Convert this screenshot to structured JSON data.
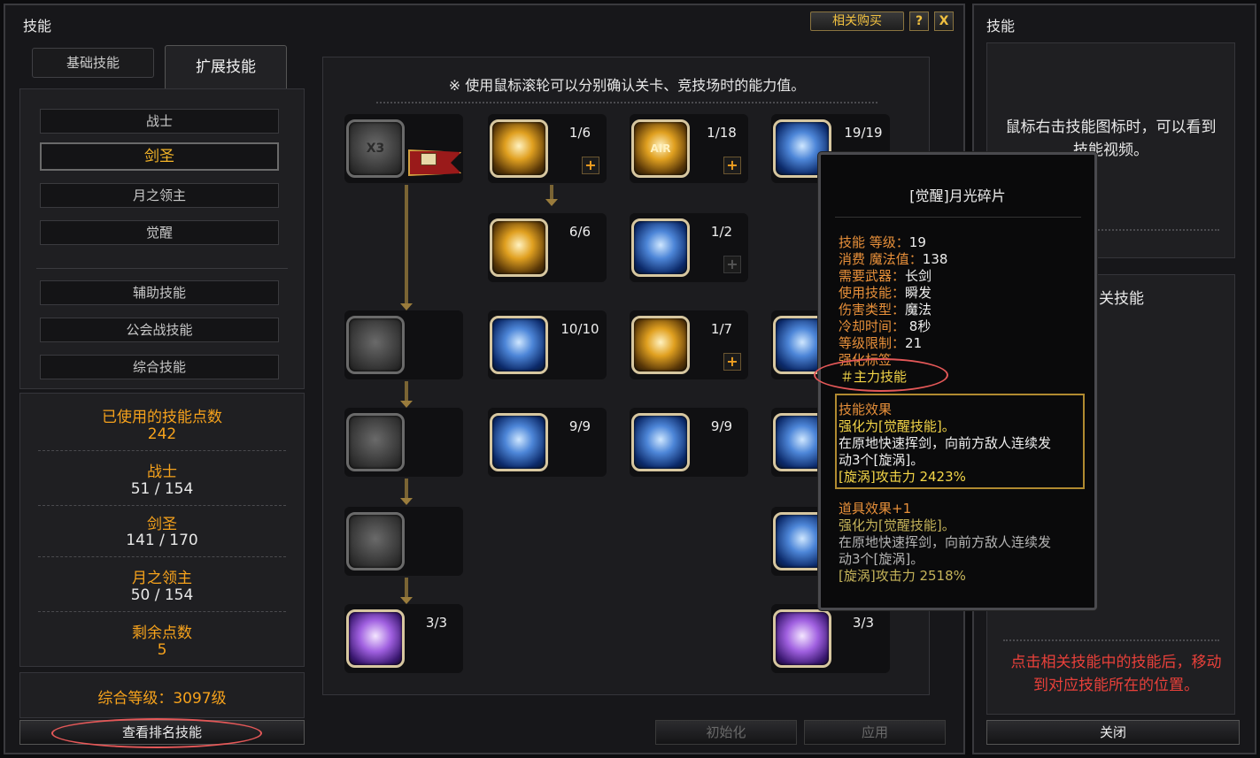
{
  "main": {
    "title": "技能",
    "buy_label": "相关购买",
    "help_label": "?",
    "close_label": "X",
    "tabs": [
      "基础技能",
      "扩展技能"
    ],
    "categories": [
      "战士",
      "剑圣",
      "月之领主",
      "觉醒",
      "辅助技能",
      "公会战技能",
      "综合技能"
    ],
    "stats": {
      "used_label": "已使用的技能点数",
      "used_value": "242",
      "c1_label": "战士",
      "c1_value": "51 / 154",
      "c2_label": "剑圣",
      "c2_value": "141 / 170",
      "c3_label": "月之领主",
      "c3_value": "50 / 154",
      "remain_label": "剩余点数",
      "remain_value": "5"
    },
    "level_text": "综合等级：3097级",
    "rank_button": "查看排名技能",
    "reset_button": "初始化",
    "apply_button": "应用",
    "hint": "※ 使用鼠标滚轮可以分别确认关卡、竞技场时的能力值。",
    "skills": [
      {
        "level": "1/6"
      },
      {
        "level": "1/18"
      },
      {
        "level": "19/19"
      },
      {
        "level": "6/6"
      },
      {
        "level": "1/2"
      },
      {
        "level": "10/10"
      },
      {
        "level": "1/7"
      },
      {
        "level": "9/9"
      },
      {
        "level": "9/9"
      },
      {
        "level": "3/3"
      },
      {
        "level": "3/3"
      }
    ],
    "icon_text": {
      "x3": "X3",
      "air": "AIR"
    }
  },
  "tooltip": {
    "title": "[觉醒]月光碎片",
    "rows": [
      {
        "k": "技能 等级",
        "v": "19"
      },
      {
        "k": "消费 魔法值",
        "v": "138"
      },
      {
        "k": "需要武器",
        "v": "长剑"
      },
      {
        "k": "使用技能",
        "v": "瞬发"
      },
      {
        "k": "伤害类型",
        "v": "魔法"
      },
      {
        "k": "冷却时间",
        "v": "  8秒"
      },
      {
        "k": "等级限制",
        "v": "21"
      }
    ],
    "sep": "：",
    "tag_label": "强化标签",
    "tag_value": "＃主力技能",
    "effect_title": "技能效果",
    "effect_line1": "强化为[觉醒技能]。",
    "effect_line2": "在原地快速挥剑，向前方敌人连续发",
    "effect_line3": "动3个[旋涡]。",
    "effect_line4": "[旋涡]攻击力 2423%",
    "item_title": "道具效果+1",
    "item_line1": "强化为[觉醒技能]。",
    "item_line2": "在原地快速挥剑，向前方敌人连续发",
    "item_line3": "动3个[旋涡]。",
    "item_line4": "[旋涡]攻击力 2518%"
  },
  "right": {
    "title": "技能",
    "video_hint_1": "鼠标右击技能图标时，可以看到",
    "video_hint_2": "技能视频。",
    "related_title": "关技能",
    "nav_hint_1": "点击相关技能中的技能后，移动",
    "nav_hint_2": "到对应技能所在的位置。",
    "close_button": "关闭"
  },
  "colors": {
    "accent": "#f6a21c",
    "highlight": "#e45858",
    "tooltip_key": "#e8903a"
  }
}
